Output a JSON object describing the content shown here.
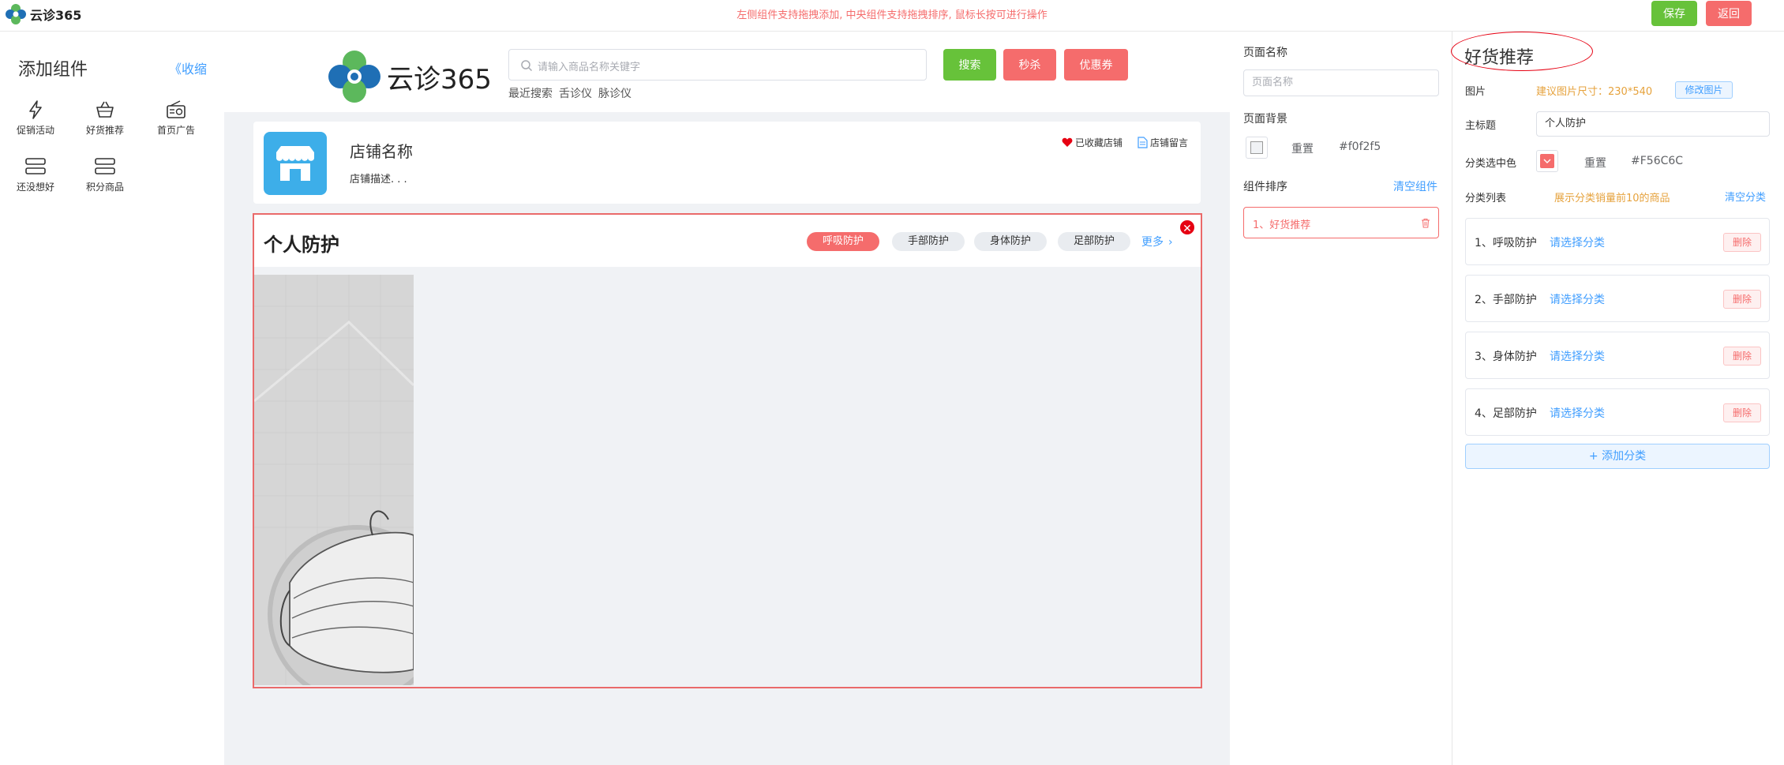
{
  "app": {
    "brand": "云诊365"
  },
  "topbar": {
    "tip": "左侧组件支持拖拽添加, 中央组件支持拖拽排序, 鼠标长按可进行操作",
    "save_label": "保存",
    "back_label": "返回"
  },
  "left": {
    "title": "添加组件",
    "collapse_label": "《收缩",
    "components": [
      {
        "label": "促销活动",
        "icon": "lightning-icon"
      },
      {
        "label": "好货推荐",
        "icon": "basket-icon"
      },
      {
        "label": "首页广告",
        "icon": "radio-icon"
      },
      {
        "label": "还没想好",
        "icon": "list-icon"
      },
      {
        "label": "积分商品",
        "icon": "list-icon"
      }
    ]
  },
  "center": {
    "brand": "云诊365",
    "search_placeholder": "请输入商品名称关键字",
    "btn_search": "搜索",
    "btn_seckill": "秒杀",
    "btn_coupon": "优惠券",
    "recent_label": "最近搜索",
    "recent_items": [
      "舌诊仪",
      "脉诊仪"
    ],
    "store_name": "店铺名称",
    "store_desc": "店铺描述. . .",
    "fav_label": "已收藏店铺",
    "msg_label": "店铺留言",
    "goods_title": "个人防护",
    "tabs": [
      "呼吸防护",
      "手部防护",
      "身体防护",
      "足部防护"
    ],
    "more_label": "更多"
  },
  "mid": {
    "page_name_label": "页面名称",
    "page_name_placeholder": "页面名称",
    "page_bg_label": "页面背景",
    "reset_label": "重置",
    "bg_color": "#f0f2f5",
    "bg_color_text": "#f0f2f5",
    "sort_label": "组件排序",
    "clear_components": "清空组件",
    "sort_items": [
      "1、好货推荐"
    ]
  },
  "right": {
    "title": "好货推荐",
    "image_label": "图片",
    "image_hint": "建议图片尺寸：230*540",
    "modify_image": "修改图片",
    "main_title_label": "主标题",
    "main_title_value": "个人防护",
    "selected_color_label": "分类选中色",
    "reset_label": "重置",
    "selected_color": "#F56C6C",
    "selected_color_text": "#F56C6C",
    "list_label": "分类列表",
    "list_hint": "展示分类销量前10的商品",
    "clear_categories": "清空分类",
    "categories": [
      {
        "name": "1、呼吸防护",
        "pick": "请选择分类",
        "delete": "删除"
      },
      {
        "name": "2、手部防护",
        "pick": "请选择分类",
        "delete": "删除"
      },
      {
        "name": "3、身体防护",
        "pick": "请选择分类",
        "delete": "删除"
      },
      {
        "name": "4、足部防护",
        "pick": "请选择分类",
        "delete": "删除"
      }
    ],
    "add_category": "+ 添加分类"
  }
}
